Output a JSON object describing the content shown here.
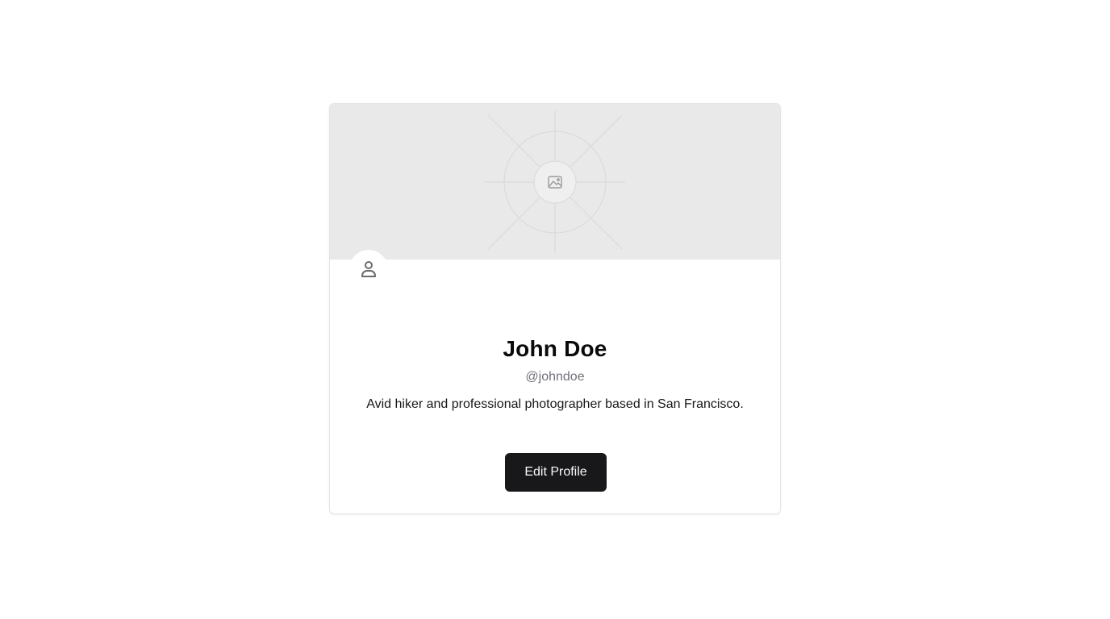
{
  "profile": {
    "name": "John Doe",
    "handle": "@johndoe",
    "bio": "Avid hiker and professional photographer based in San Francisco.",
    "edit_label": "Edit Profile"
  },
  "icons": {
    "cover": "image-placeholder-icon",
    "avatar": "user-icon"
  },
  "colors": {
    "cover_bg": "#e9e9e9",
    "button_bg": "#18181b",
    "button_text": "#fafafa",
    "handle_text": "#71717a"
  }
}
